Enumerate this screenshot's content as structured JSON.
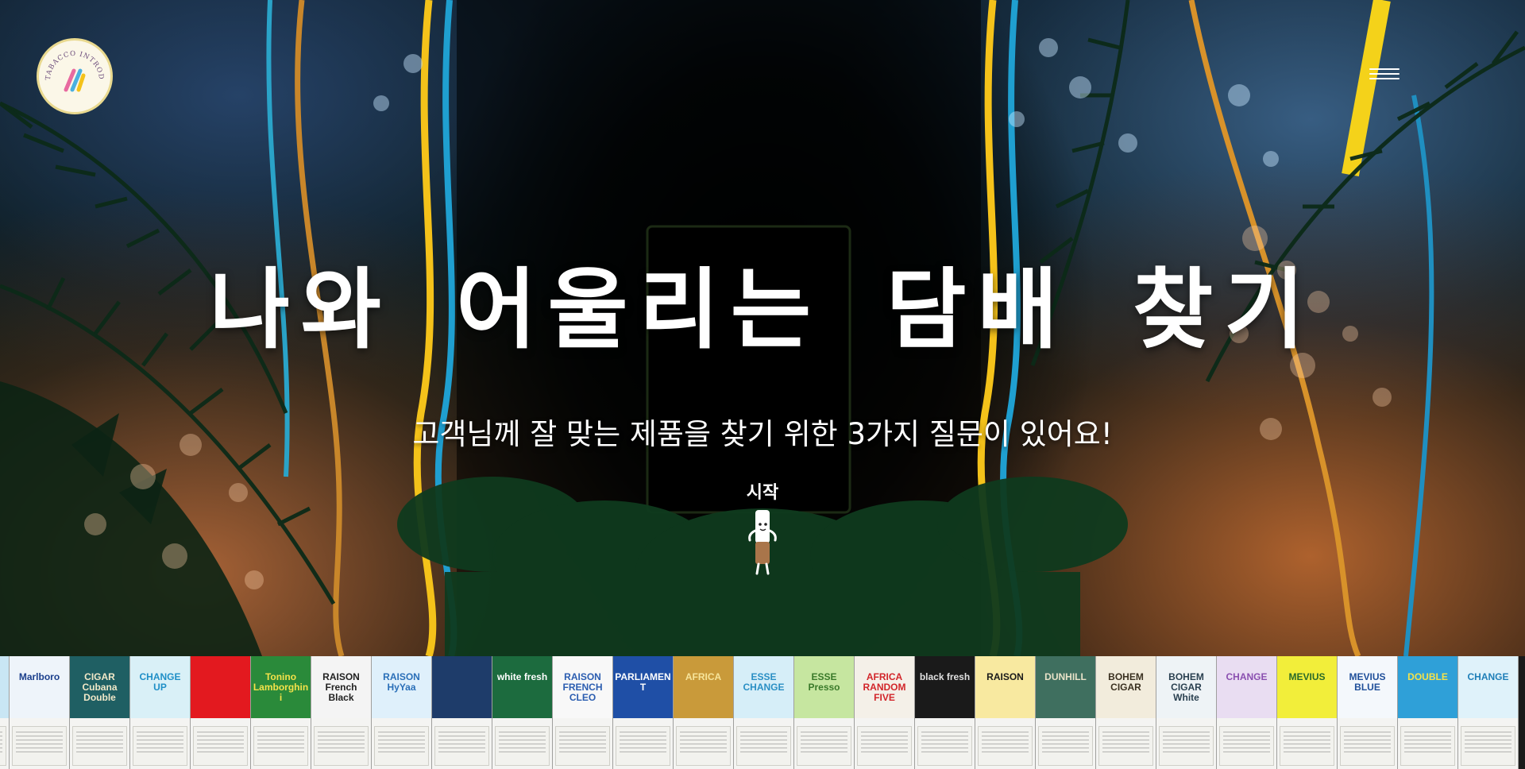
{
  "header": {
    "logo_text": "TABACCO INTRODUCTION",
    "logo_icon": "tobacco-logo-icon",
    "menu_icon": "hamburger-menu-icon"
  },
  "hero": {
    "title": "나와 어울리는 담배 찾기",
    "subtitle": "고객님께 잘 맞는 제품을 찾기 위한 3가지 질문이 있어요!",
    "start_label": "시작",
    "start_icon": "cigarette-mascot-icon"
  },
  "product_strip": {
    "packs": [
      {
        "name": "",
        "top": "#c9e6f4",
        "text": "#1b5a9b"
      },
      {
        "name": "Marlboro",
        "top": "#eef4fa",
        "text": "#1b3f8c"
      },
      {
        "name": "CIGAR Cubana Double",
        "top": "#1f5f63",
        "text": "#f1e8c8"
      },
      {
        "name": "CHANGE UP",
        "top": "#d9f0f7",
        "text": "#1f8fc7"
      },
      {
        "name": "",
        "top": "#e3191f",
        "text": "#ffffff"
      },
      {
        "name": "Tonino Lamborghini",
        "top": "#2a8a3a",
        "text": "#f4e24a"
      },
      {
        "name": "RAISON French Black",
        "top": "#f4f4f4",
        "text": "#222222"
      },
      {
        "name": "RAISON HyYaa",
        "top": "#dff0fb",
        "text": "#2a6fb8"
      },
      {
        "name": "",
        "top": "#1e3c6a",
        "text": "#ffffff"
      },
      {
        "name": "white fresh",
        "top": "#1c6b3e",
        "text": "#ffffff"
      },
      {
        "name": "RAISON FRENCH CLEO",
        "top": "#f8f8f8",
        "text": "#2b5db0"
      },
      {
        "name": "PARLIAMENT",
        "top": "#1f4fa6",
        "text": "#ffffff"
      },
      {
        "name": "AFRICA",
        "top": "#c99a3a",
        "text": "#f6e49a"
      },
      {
        "name": "ESSE CHANGE",
        "top": "#d6eef8",
        "text": "#2a8fc4"
      },
      {
        "name": "ESSE Presso",
        "top": "#c6e6a0",
        "text": "#3a7a2a"
      },
      {
        "name": "AFRICA RANDOM FIVE",
        "top": "#f4f0e8",
        "text": "#d2252a"
      },
      {
        "name": "black fresh",
        "top": "#1a1a1a",
        "text": "#e0e0e0"
      },
      {
        "name": "RAISON",
        "top": "#f8e9a0",
        "text": "#1a1a1a"
      },
      {
        "name": "DUNHILL",
        "top": "#3f6f5f",
        "text": "#e8e2c8"
      },
      {
        "name": "BOHEM CIGAR",
        "top": "#f2ecdc",
        "text": "#3a3020"
      },
      {
        "name": "BOHEM CIGAR White",
        "top": "#eef3f6",
        "text": "#2a4050"
      },
      {
        "name": "CHANGE",
        "top": "#e9ddf2",
        "text": "#8a4fb0"
      },
      {
        "name": "MEVIUS",
        "top": "#f2ee3a",
        "text": "#2a6a2a"
      },
      {
        "name": "MEVIUS BLUE",
        "top": "#f4f8fc",
        "text": "#1f4f9a"
      },
      {
        "name": "DOUBLE",
        "top": "#2fa0d8",
        "text": "#f4e24a"
      },
      {
        "name": "CHANGE",
        "top": "#dff2fa",
        "text": "#1f7fb8"
      }
    ]
  }
}
